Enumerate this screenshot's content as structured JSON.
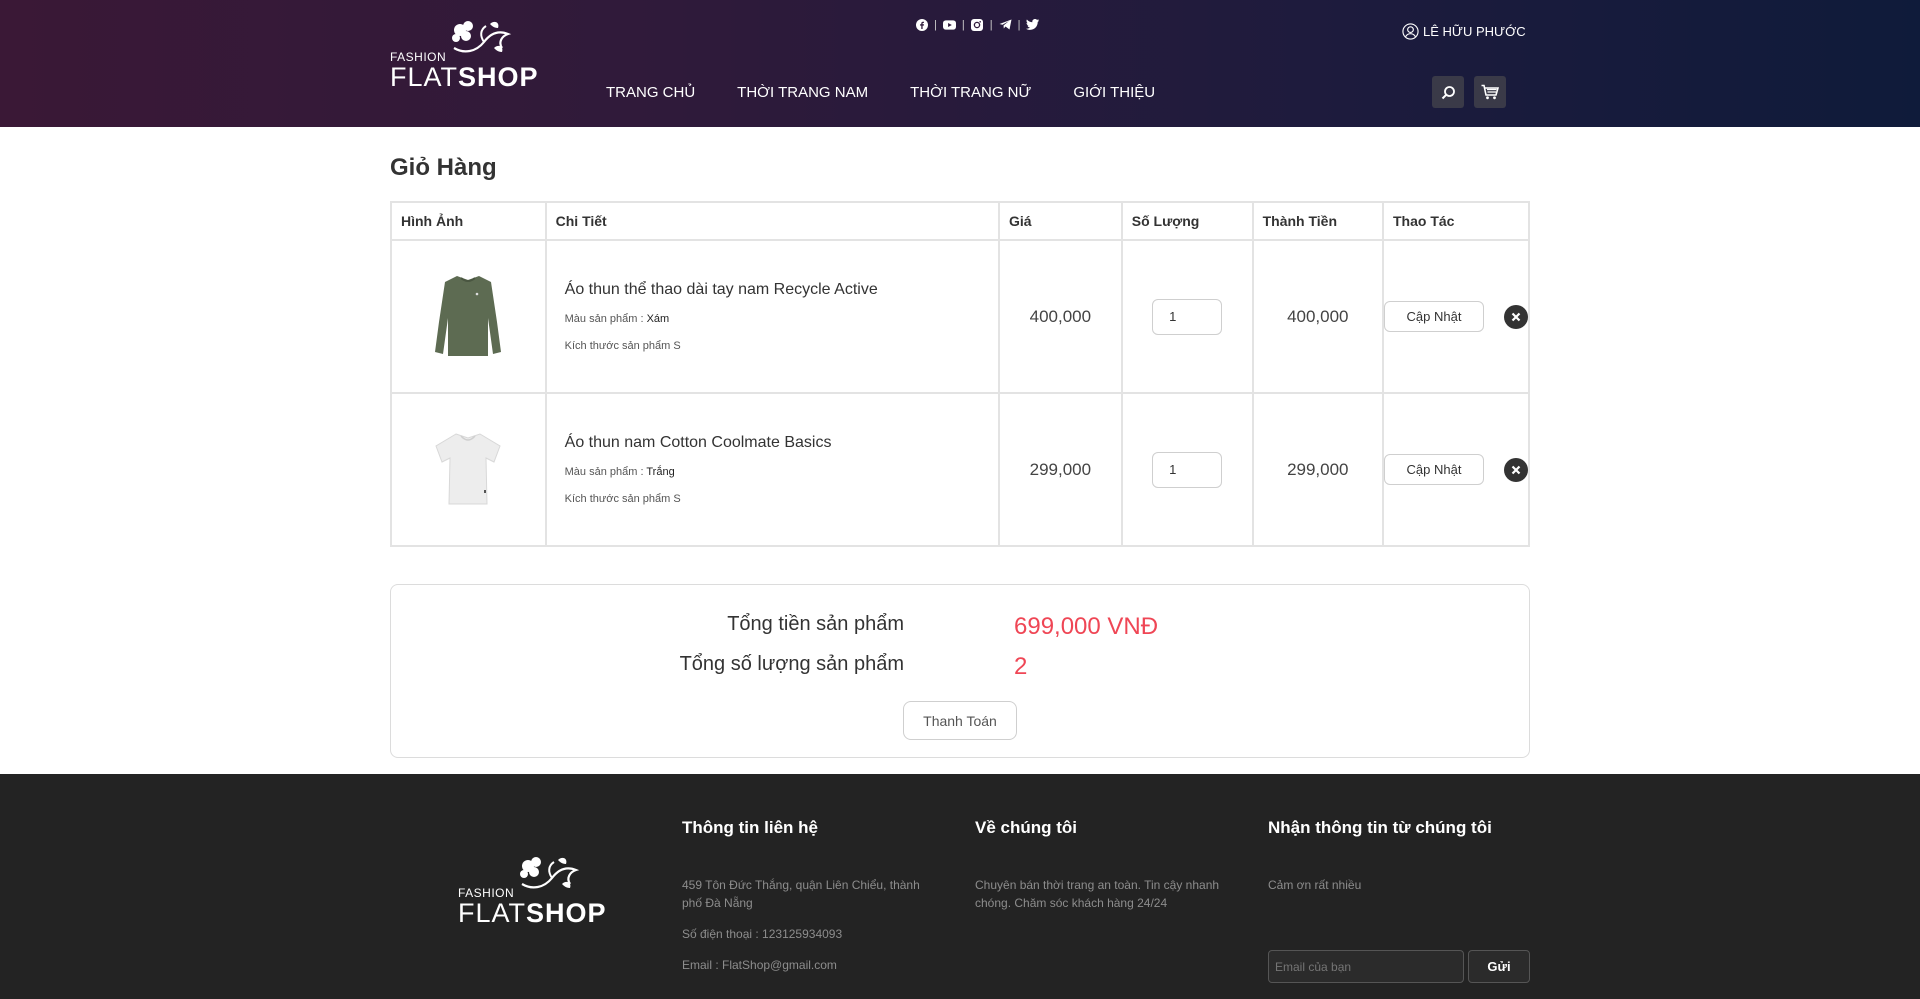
{
  "brand": {
    "fashion": "FASHION",
    "flat": "FLAT",
    "shop": "SHOP"
  },
  "header": {
    "user_name": "LÊ HỮU PHƯỚC",
    "social": [
      "facebook-icon",
      "youtube-icon",
      "instagram-icon",
      "telegram-icon",
      "twitter-icon"
    ],
    "nav": [
      "TRANG CHỦ",
      "THỜI TRANG NAM",
      "THỜI TRANG NỮ",
      "GIỚI THIỆU"
    ]
  },
  "cart": {
    "title": "Giỏ Hàng",
    "columns": [
      "Hình Ảnh",
      "Chi Tiết",
      "Giá",
      "Số Lượng",
      "Thành Tiền",
      "Thao Tác"
    ],
    "items": [
      {
        "name": "Áo thun thể thao dài tay nam Recycle Active",
        "color_label": "Màu sản phẩm : ",
        "color": "Xám",
        "size_label": "Kích thước sản phẩm S",
        "price": "400,000",
        "quantity": "1",
        "total": "400,000",
        "update_label": "Cập Nhật",
        "image_color": "#5d6b52"
      },
      {
        "name": "Áo thun nam Cotton Coolmate Basics",
        "color_label": "Màu sản phẩm : ",
        "color": "Trắng",
        "size_label": "Kích thước sản phẩm S",
        "price": "299,000",
        "quantity": "1",
        "total": "299,000",
        "update_label": "Cập Nhật",
        "image_color": "#efefef"
      }
    ]
  },
  "summary": {
    "total_label": "Tổng tiền sản phẩm",
    "total_value": "699,000 VNĐ",
    "count_label": "Tổng số lượng sản phẩm",
    "count_value": "2",
    "checkout_label": "Thanh Toán",
    "accent": "#ef4655"
  },
  "footer": {
    "contact": {
      "title": "Thông tin liên hệ",
      "address": "459 Tôn Đức Thắng, quận Liên Chiểu, thành phố Đà Nẵng",
      "phone": "Số điện thoại : 123125934093",
      "email": "Email : FlatShop@gmail.com"
    },
    "about": {
      "title": "Về chúng tôi",
      "text": "Chuyên bán thời trang an toàn. Tin cậy nhanh chóng. Chăm sóc khách hàng 24/24"
    },
    "newsletter": {
      "title": "Nhận thông tin từ chúng tôi",
      "text": "Cảm ơn rất nhiều",
      "placeholder": "Email của bạn",
      "send_label": "Gửi"
    }
  }
}
